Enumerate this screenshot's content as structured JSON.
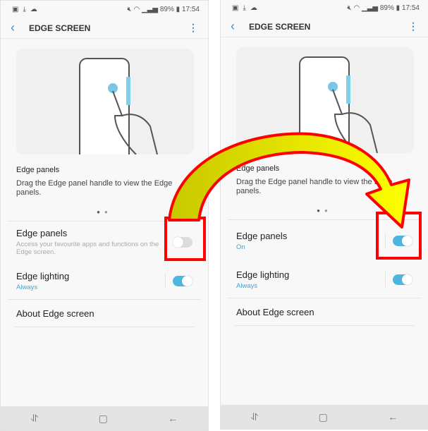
{
  "screens": [
    {
      "status": {
        "left_icons": [
          "image-icon",
          "download-icon",
          "cloud-icon"
        ],
        "battery": "89%",
        "time": "17:54"
      },
      "header": {
        "title": "EDGE SCREEN"
      },
      "caption": "Edge panels",
      "description": "Drag the Edge panel handle to view the Edge panels.",
      "items": [
        {
          "title": "Edge panels",
          "subtitle": "Access your favourite apps and functions on the Edge screen.",
          "toggle": false
        },
        {
          "title": "Edge lighting",
          "subtitle": "Always",
          "toggle": true
        },
        {
          "title": "About Edge screen"
        }
      ]
    },
    {
      "status": {
        "left_icons": [
          "image-icon",
          "download-icon",
          "cloud-icon"
        ],
        "battery": "89%",
        "time": "17:54"
      },
      "header": {
        "title": "EDGE SCREEN"
      },
      "caption": "Edge panels",
      "description": "Drag the Edge panel handle to view the Edge panels.",
      "items": [
        {
          "title": "Edge panels",
          "subtitle": "On",
          "toggle": true
        },
        {
          "title": "Edge lighting",
          "subtitle": "Always",
          "toggle": true
        },
        {
          "title": "About Edge screen"
        }
      ]
    }
  ],
  "annotation": {
    "arrow_fill": "#d6d600",
    "outline_color": "#ff0000"
  }
}
